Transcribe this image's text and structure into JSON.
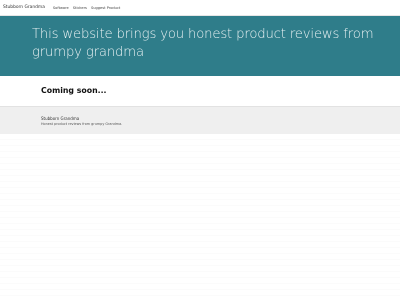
{
  "nav": {
    "brand": "Stubborn Grandma",
    "items": [
      {
        "label": "Software"
      },
      {
        "label": "Stickers"
      },
      {
        "label": "Suggest Product"
      }
    ]
  },
  "hero": {
    "text": "This website brings you honest product reviews from grumpy grandma"
  },
  "main": {
    "heading": "Coming soon..."
  },
  "footer": {
    "title": "Stubborn Grandma",
    "subtitle": "Honest product reviews from grumpy Grandma."
  },
  "colors": {
    "hero_bg": "#2f7d8a",
    "footer_bg": "#efefef"
  }
}
